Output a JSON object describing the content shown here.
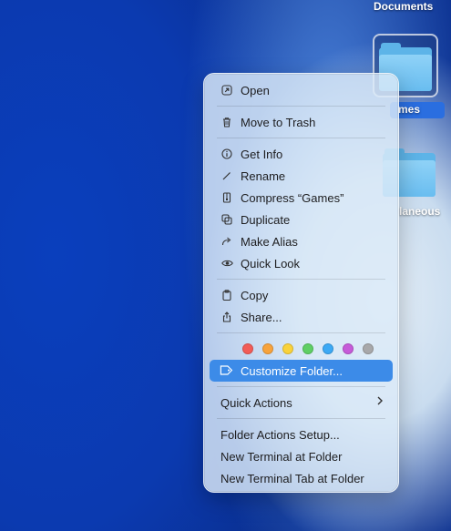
{
  "desktop": {
    "documents_label": "Documents",
    "games_label_partial": "mes",
    "misc_label_partial": "laneous"
  },
  "menu": {
    "open": "Open",
    "move_to_trash": "Move to Trash",
    "get_info": "Get Info",
    "rename": "Rename",
    "compress": "Compress “Games”",
    "duplicate": "Duplicate",
    "make_alias": "Make Alias",
    "quick_look": "Quick Look",
    "copy": "Copy",
    "share": "Share...",
    "customize_folder": "Customize Folder...",
    "quick_actions": "Quick Actions",
    "folder_actions_setup": "Folder Actions Setup...",
    "new_terminal_at_folder": "New Terminal at Folder",
    "new_terminal_tab_at_folder": "New Terminal Tab at Folder"
  },
  "tag_colors": [
    "#f25c57",
    "#f7a33c",
    "#f9d23b",
    "#5fcf65",
    "#3ca9f5",
    "#c65bd9",
    "#a8a8aa"
  ],
  "icons": {
    "open": "arrow-up-right-square-icon",
    "trash": "trash-icon",
    "info": "info-circle-icon",
    "rename": "pencil-icon",
    "compress": "archive-icon",
    "duplicate": "duplicate-icon",
    "alias": "arrow-turn-icon",
    "quick_look": "eye-icon",
    "copy": "clipboard-icon",
    "share": "share-icon",
    "tag": "tag-icon",
    "chevron": "chevron-right-icon"
  }
}
